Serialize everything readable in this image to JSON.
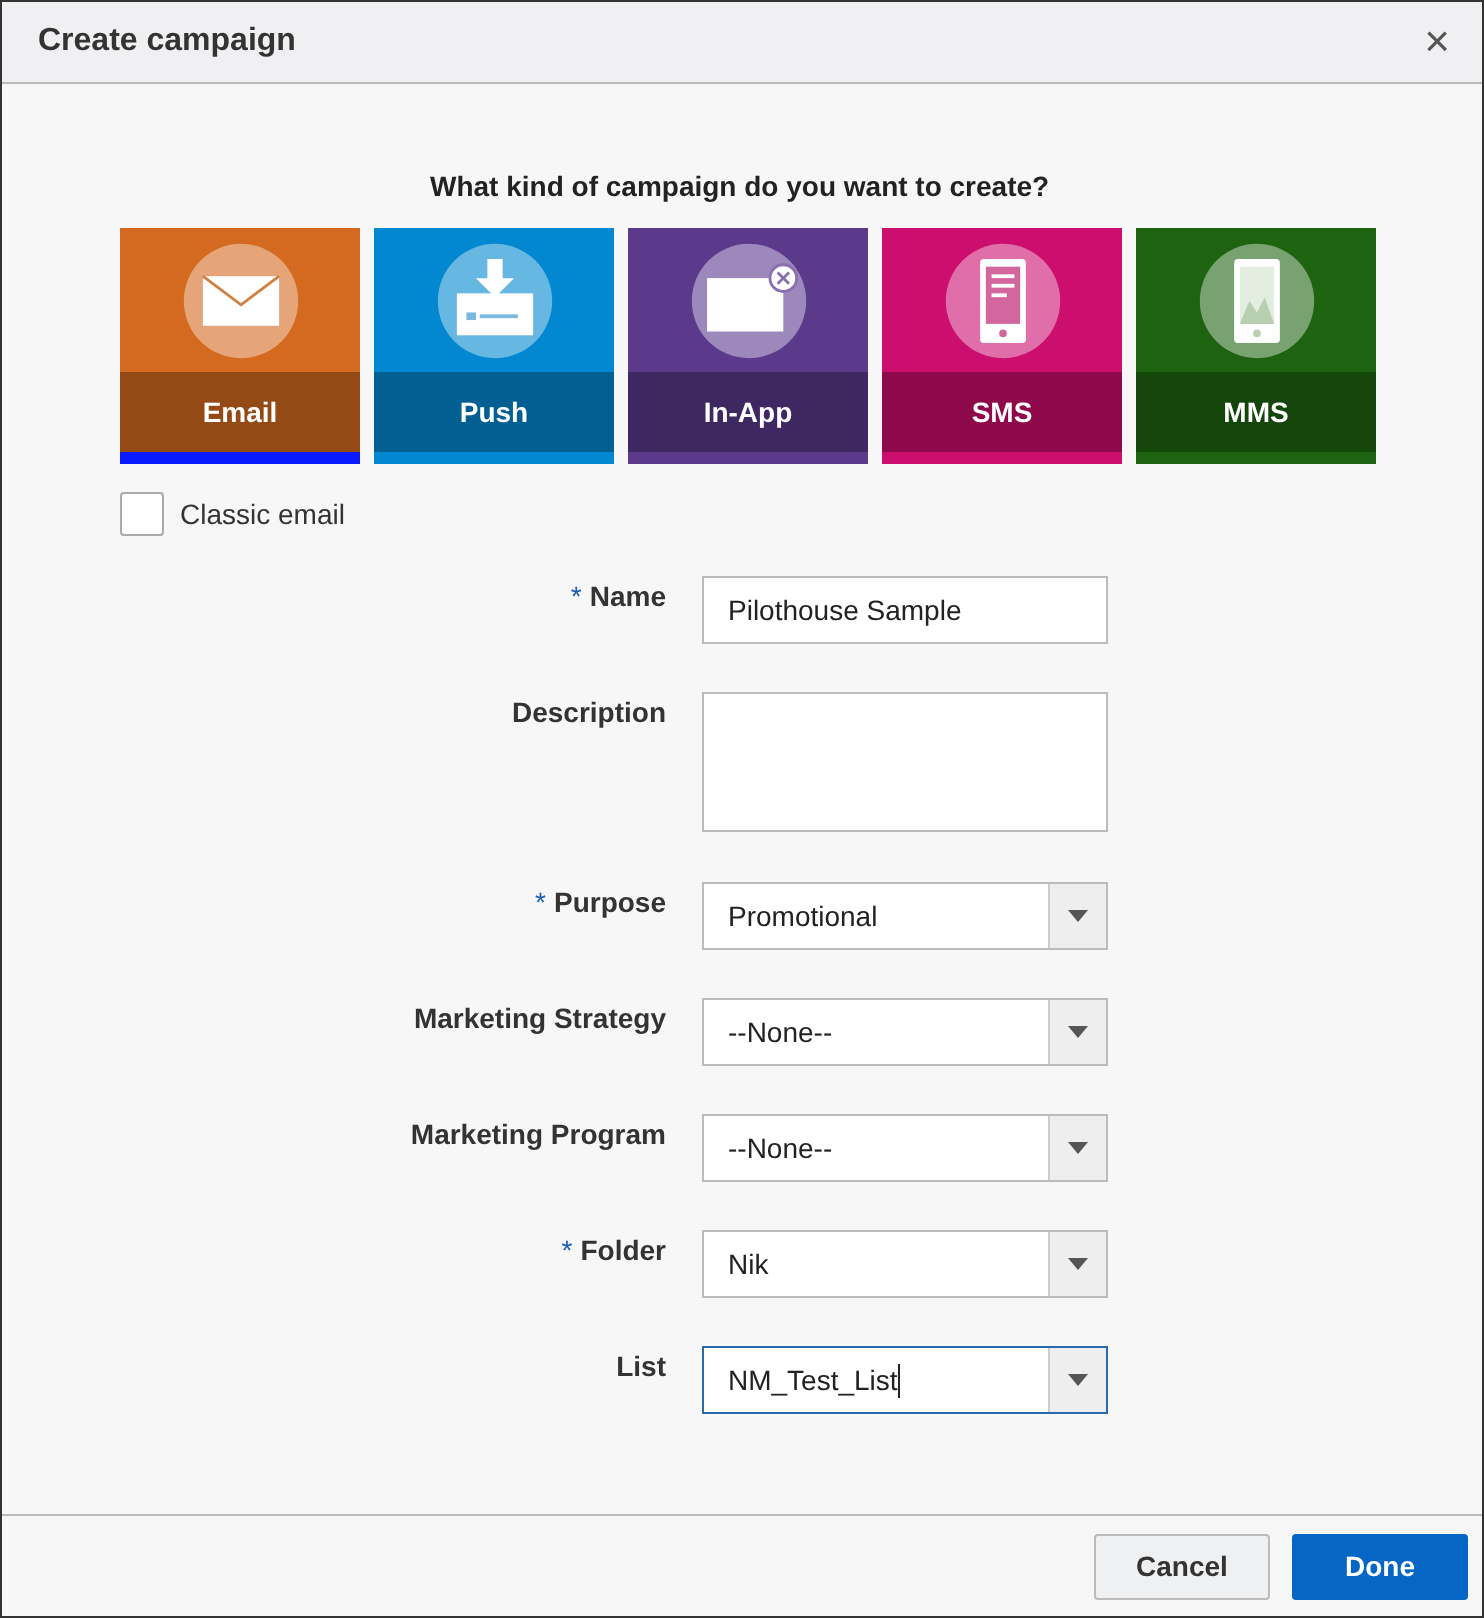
{
  "window": {
    "title": "Create campaign",
    "close": "×"
  },
  "prompt": "What kind of campaign do you want to create?",
  "campaign_types": [
    {
      "label": "Email",
      "kind": "email",
      "color": "#d46a1f",
      "selected": true
    },
    {
      "label": "Push",
      "kind": "push",
      "color": "#0288d1",
      "selected": false
    },
    {
      "label": "In-App",
      "kind": "inapp",
      "color": "#5b3a8c",
      "selected": false
    },
    {
      "label": "SMS",
      "kind": "sms",
      "color": "#cc0e6e",
      "selected": false
    },
    {
      "label": "MMS",
      "kind": "mms",
      "color": "#1e6410",
      "selected": false
    }
  ],
  "classic_email": {
    "label": "Classic email",
    "checked": false
  },
  "fields": [
    {
      "label": "Name",
      "required_mark": "*",
      "kind": "text",
      "value": "Pilothouse Sample",
      "focused": false
    },
    {
      "label": "Description",
      "kind": "textarea",
      "focused": false
    },
    {
      "label": "Purpose",
      "required_mark": "*",
      "kind": "select",
      "value": "Promotional",
      "focused": false
    },
    {
      "label": "Marketing Strategy",
      "kind": "select",
      "value": "--None--",
      "focused": false
    },
    {
      "label": "Marketing Program",
      "kind": "select",
      "value": "--None--",
      "focused": false
    },
    {
      "label": "Folder",
      "required_mark": "*",
      "kind": "select",
      "value": "Nik",
      "focused": false
    },
    {
      "label": "List",
      "kind": "select",
      "value": "NM_Test_List",
      "focused": true
    }
  ],
  "buttons": [
    {
      "label": "Cancel",
      "kind": "secondary"
    },
    {
      "label": "Done",
      "kind": "primary"
    }
  ]
}
